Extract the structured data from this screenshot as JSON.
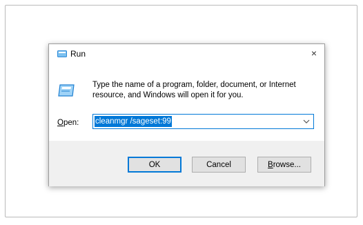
{
  "dialog": {
    "title": "Run",
    "close_glyph": "×",
    "instruction": "Type the name of a program, folder, document, or Internet resource, and Windows will open it for you.",
    "open_label": "Open:",
    "open_value": "cleanmgr /sageset:99",
    "buttons": {
      "ok": "OK",
      "cancel": "Cancel",
      "browse": "Browse..."
    },
    "icons": {
      "title": "run-icon",
      "big": "run-icon",
      "dropdown": "chevron-down-icon",
      "close": "close-icon"
    },
    "colors": {
      "accent": "#0078d7",
      "button_area": "#f0f0f0"
    }
  }
}
